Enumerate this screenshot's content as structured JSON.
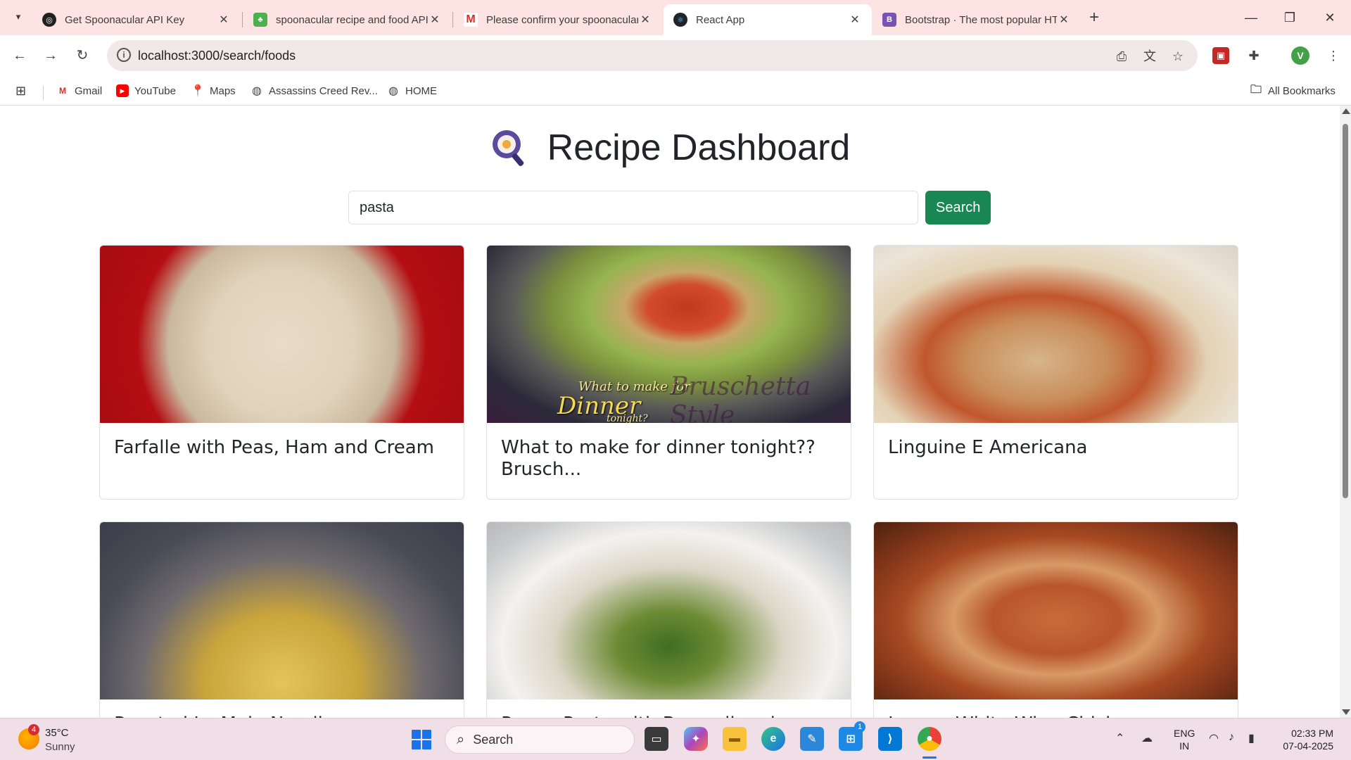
{
  "browser": {
    "tabs": [
      {
        "title": "Get Spoonacular API Key",
        "active": false
      },
      {
        "title": "spoonacular recipe and food API",
        "active": false
      },
      {
        "title": "Please confirm your spoonacular",
        "active": false
      },
      {
        "title": "React App",
        "active": true
      },
      {
        "title": "Bootstrap · The most popular HTML",
        "active": false
      }
    ],
    "url": "localhost:3000/search/foods",
    "bookmarks": [
      "Gmail",
      "YouTube",
      "Maps",
      "Assassins Creed Rev...",
      "HOME"
    ],
    "all_bookmarks_label": "All Bookmarks",
    "profile_initial": "V"
  },
  "page": {
    "title": "Recipe Dashboard",
    "search": {
      "value": "pasta",
      "button_label": "Search"
    },
    "recipes": [
      {
        "title": "Farfalle with Peas, Ham and Cream"
      },
      {
        "title": "What to make for dinner tonight?? Brusch...",
        "image_text": [
          "What to make for",
          "Dinner",
          "tonight?",
          "Bruschetta Style"
        ]
      },
      {
        "title": "Linguine E Americana"
      },
      {
        "title": "Roasted Lo Mein Noodles"
      },
      {
        "title": "Penne Pasta with Broccoli and Cheese"
      },
      {
        "title": "Lemon White Wine Chicken over Linguine"
      }
    ]
  },
  "taskbar": {
    "weather": {
      "temp": "35°C",
      "condition": "Sunny",
      "badge": "4"
    },
    "search_placeholder": "Search",
    "store_badge": "1",
    "language": {
      "line1": "ENG",
      "line2": "IN"
    },
    "clock": {
      "time": "02:33 PM",
      "date": "07-04-2025"
    }
  },
  "colors": {
    "tab_strip": "#fde4e2",
    "search_button": "#198754",
    "taskbar": "#f0dfe6"
  }
}
